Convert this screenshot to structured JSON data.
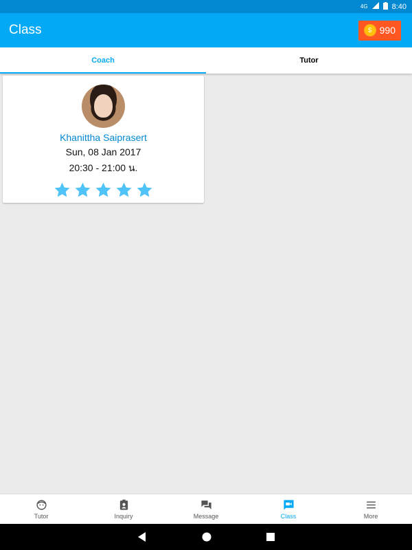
{
  "status_bar": {
    "network": "4G",
    "time": "8:40"
  },
  "app_bar": {
    "title": "Class",
    "coins": "990"
  },
  "tabs": [
    {
      "label": "Coach",
      "active": true
    },
    {
      "label": "Tutor",
      "active": false
    }
  ],
  "class_card": {
    "tutor_name": "Khanittha Saiprasert",
    "date": "Sun, 08 Jan 2017",
    "time": "20:30 - 21:00 น.",
    "rating": 5,
    "rating_max": 5
  },
  "bottom_nav": [
    {
      "label": "Tutor",
      "icon": "face-icon",
      "active": false
    },
    {
      "label": "Inquiry",
      "icon": "contact-icon",
      "active": false
    },
    {
      "label": "Message",
      "icon": "chat-icon",
      "active": false
    },
    {
      "label": "Class",
      "icon": "video-icon",
      "active": true
    },
    {
      "label": "More",
      "icon": "menu-icon",
      "active": false
    }
  ],
  "colors": {
    "primary": "#03a9f4",
    "primary_dark": "#0288d1",
    "coin_button": "#ff5722",
    "star": "#4fc3f7"
  }
}
